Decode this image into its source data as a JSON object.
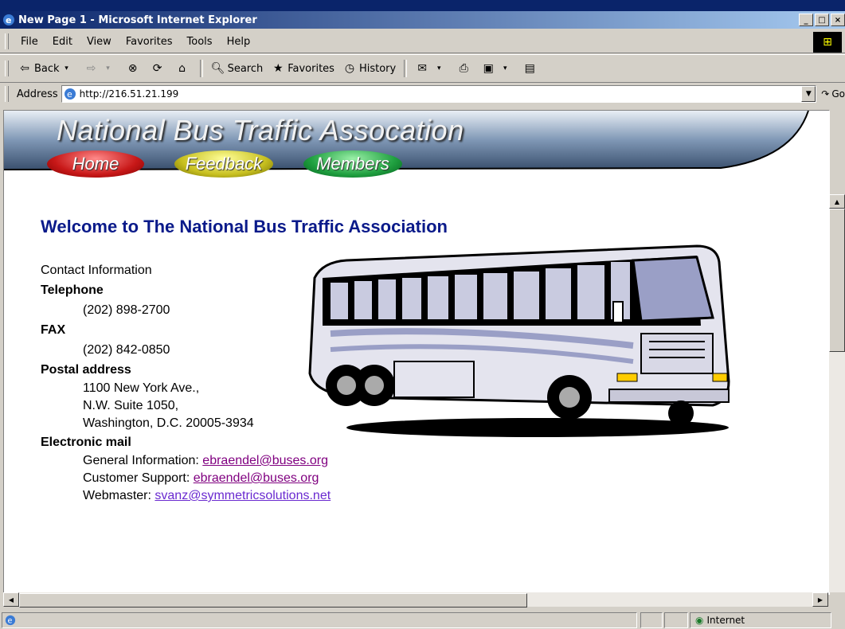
{
  "window": {
    "title": "New Page 1 - Microsoft Internet Explorer",
    "btn_min": "_",
    "btn_max": "□",
    "btn_close": "×"
  },
  "menu": [
    "File",
    "Edit",
    "View",
    "Favorites",
    "Tools",
    "Help"
  ],
  "toolbar": {
    "back": "Back",
    "search": "Search",
    "favorites": "Favorites",
    "history": "History"
  },
  "address": {
    "label": "Address",
    "url": "http://216.51.21.199",
    "go": "Go"
  },
  "site": {
    "title": "National Bus Traffic Assocation",
    "nav": [
      {
        "label": "Home",
        "color": "#d02020"
      },
      {
        "label": "Feedback",
        "color": "#c8c020"
      },
      {
        "label": "Members",
        "color": "#20a040"
      }
    ],
    "welcome": "Welcome to The National Bus Traffic Association",
    "contact_heading": "Contact Information",
    "telephone_label": "Telephone",
    "telephone": "(202) 898-2700",
    "fax_label": "FAX",
    "fax": "(202) 842-0850",
    "postal_label": "Postal address",
    "postal_line1": "1100 New York Ave.,",
    "postal_line2": "N.W. Suite 1050,",
    "postal_line3": "Washington, D.C. 20005-3934",
    "email_label": "Electronic mail",
    "general_label": "General Information: ",
    "general_email": "ebraendel@buses.org",
    "support_label": "Customer Support: ",
    "support_email": "ebraendel@buses.org",
    "webmaster_label": "Webmaster: ",
    "webmaster_email": "svanz@symmetricsolutions.net"
  },
  "status": {
    "zone": "Internet"
  }
}
